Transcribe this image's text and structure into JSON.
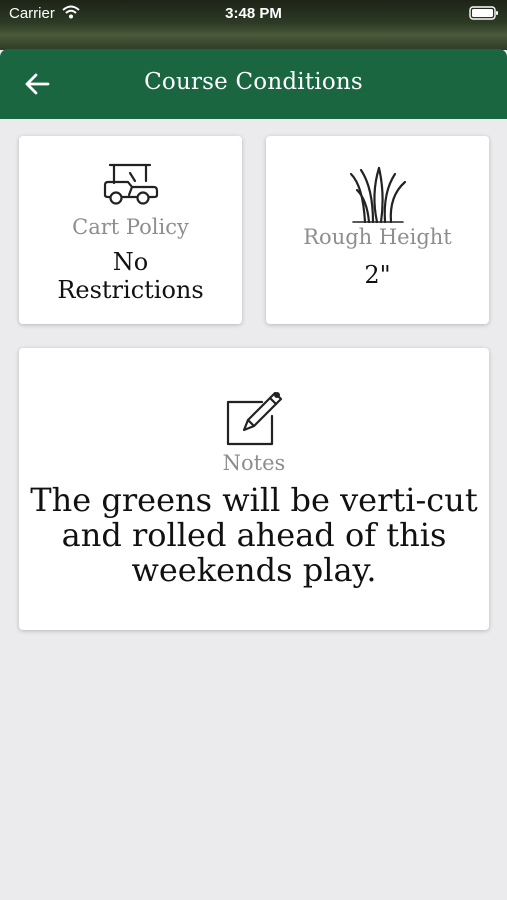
{
  "status_bar": {
    "carrier": "Carrier",
    "time": "3:48 PM"
  },
  "nav": {
    "title": "Course Conditions",
    "back_icon": "arrow-left-icon"
  },
  "cart_policy": {
    "icon": "golf-cart-icon",
    "label": "Cart Policy",
    "value_line1": "No",
    "value_line2": "Restrictions"
  },
  "rough_height": {
    "icon": "grass-icon",
    "label": "Rough Height",
    "value": "2\""
  },
  "notes": {
    "icon": "edit-note-icon",
    "label": "Notes",
    "text_line1": "The greens will be verti-cut",
    "text_line2": "and rolled ahead of this",
    "text_line3": "weekends play."
  },
  "colors": {
    "header_green": "#1a6641",
    "background": "#ebebed",
    "label_gray": "#8e8e8e"
  }
}
